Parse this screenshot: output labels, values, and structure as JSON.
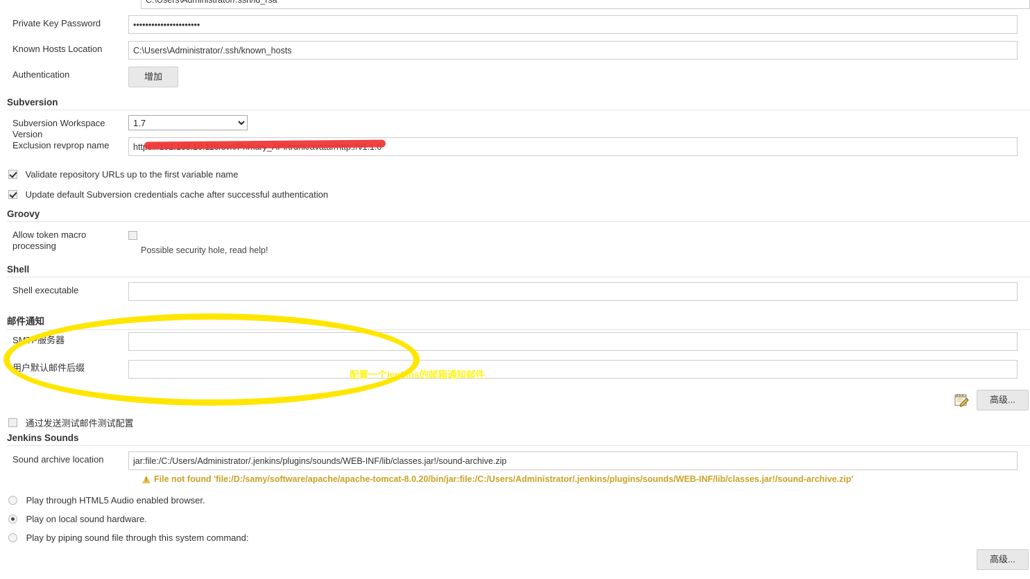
{
  "top_clipped_field": {
    "value": "C:\\Users\\Administrator/.ssh/id_rsa"
  },
  "ssh": {
    "private_key_password_label": "Private Key Password",
    "private_key_password_value": "••••••••••••••••••••••",
    "known_hosts_label": "Known Hosts Location",
    "known_hosts_value": "C:\\Users\\Administrator/.ssh/known_hosts",
    "authentication_label": "Authentication",
    "add_button_label": "增加"
  },
  "subversion": {
    "section_title": "Subversion",
    "workspace_version_label": "Subversion Workspace Version",
    "workspace_version_value": "1.7",
    "workspace_version_options": [
      "1.7"
    ],
    "exclusion_revprop_label": "Exclusion revprop name",
    "exclusion_revprop_value": "https://192.168.10.110/svn/Primary_API/trunk/avatar/http://v1.1.0",
    "validate_urls_label": "Validate repository URLs up to the first variable name",
    "validate_urls_checked": true,
    "update_cache_label": "Update default Subversion credentials cache after successful authentication",
    "update_cache_checked": true
  },
  "groovy": {
    "section_title": "Groovy",
    "allow_token_macro_label": "Allow token macro processing",
    "allow_token_macro_checked": false,
    "security_hint": "Possible security hole, read help!"
  },
  "shell": {
    "section_title": "Shell",
    "shell_executable_label": "Shell executable",
    "shell_executable_value": ""
  },
  "mail": {
    "section_title": "邮件通知",
    "smtp_server_label": "SMTP服务器",
    "smtp_server_value": "",
    "default_suffix_label": "用户默认邮件后缀",
    "default_suffix_value": "",
    "advanced_button_label": "高级...",
    "edit_icon_name": "notepad-pencil-icon",
    "test_config_label": "通过发送测试邮件测试配置",
    "test_config_checked": false
  },
  "sounds": {
    "section_title": "Jenkins Sounds",
    "archive_location_label": "Sound archive location",
    "archive_location_value": "jar:file:/C:/Users/Administrator/.jenkins/plugins/sounds/WEB-INF/lib/classes.jar!/sound-archive.zip",
    "warning_text": "File not found 'file:/D:/samy/software/apache/apache-tomcat-8.0.20/bin/jar:file:/C:/Users/Administrator/.jenkins/plugins/sounds/WEB-INF/lib/classes.jar!/sound-archive.zip'",
    "playback_options": [
      {
        "label": "Play through HTML5 Audio enabled browser.",
        "selected": false
      },
      {
        "label": "Play on local sound hardware.",
        "selected": true
      },
      {
        "label": "Play by piping sound file through this system command:",
        "selected": false
      }
    ],
    "advanced_button_label": "高级..."
  },
  "annotations": {
    "highlight_note": "配置一个jenkins的邮箱通知邮件",
    "ellipse_color": "#ffe600",
    "note_color": "#fff41f",
    "redaction_color": "#f03434"
  }
}
